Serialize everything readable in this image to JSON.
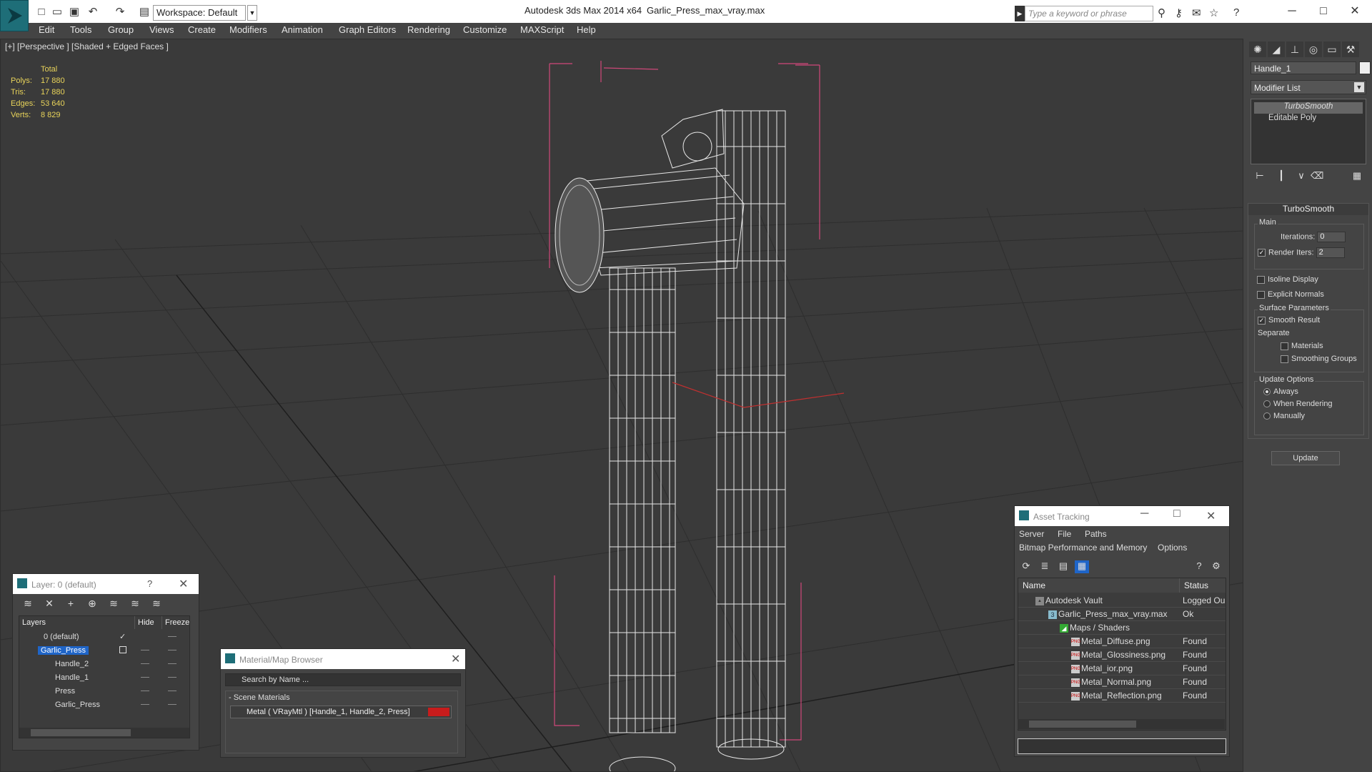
{
  "titlebar": {
    "workspace": "Workspace: Default",
    "app_title": "Autodesk 3ds Max  2014 x64",
    "file_title": "Garlic_Press_max_vray.max",
    "search_placeholder": "Type a keyword or phrase"
  },
  "menubar": [
    "Edit",
    "Tools",
    "Group",
    "Views",
    "Create",
    "Modifiers",
    "Animation",
    "Graph Editors",
    "Rendering",
    "Customize",
    "MAXScript",
    "Help"
  ],
  "viewport": {
    "label": "[+] [Perspective ] [Shaded + Edged Faces ]",
    "stats_header": "Total",
    "stats": [
      {
        "label": "Polys:",
        "value": "17 880"
      },
      {
        "label": "Tris:",
        "value": "17 880"
      },
      {
        "label": "Edges:",
        "value": "53 640"
      },
      {
        "label": "Verts:",
        "value": "8 829"
      }
    ]
  },
  "command_panel": {
    "object_name": "Handle_1",
    "modifier_list": "Modifier List",
    "stack": [
      "TurboSmooth",
      "Editable Poly"
    ],
    "turbosmooth": {
      "title": "TurboSmooth",
      "main_label": "Main",
      "iterations_label": "Iterations:",
      "iterations_value": "0",
      "render_iters_label": "Render Iters:",
      "render_iters_value": "2",
      "isoline_display": "Isoline Display",
      "explicit_normals": "Explicit Normals",
      "surface_params": "Surface Parameters",
      "smooth_result": "Smooth Result",
      "separate": "Separate",
      "materials": "Materials",
      "smoothing_groups": "Smoothing Groups",
      "update_options": "Update Options",
      "always": "Always",
      "when_rendering": "When Rendering",
      "manually": "Manually",
      "update_button": "Update"
    }
  },
  "layer_panel": {
    "title": "Layer: 0 (default)",
    "help": "?",
    "col_layers": "Layers",
    "col_hide": "Hide",
    "col_freeze": "Freeze",
    "rows": [
      "0 (default)",
      "Garlic_Press",
      "Handle_2",
      "Handle_1",
      "Press",
      "Garlic_Press"
    ]
  },
  "material_panel": {
    "title": "Material/Map Browser",
    "search_placeholder": "Search by Name ...",
    "section": "- Scene Materials",
    "item": "Metal  ( VRayMtl )  [Handle_1, Handle_2, Press]"
  },
  "asset_panel": {
    "title": "Asset Tracking",
    "menu": [
      "Server",
      "File",
      "Paths",
      "Bitmap Performance and Memory",
      "Options"
    ],
    "col_name": "Name",
    "col_status": "Status",
    "rows": [
      {
        "name": "Autodesk Vault",
        "status": "Logged Ou"
      },
      {
        "name": "Garlic_Press_max_vray.max",
        "status": "Ok"
      },
      {
        "name": "Maps / Shaders",
        "status": ""
      },
      {
        "name": "Metal_Diffuse.png",
        "status": "Found"
      },
      {
        "name": "Metal_Glossiness.png",
        "status": "Found"
      },
      {
        "name": "Metal_ior.png",
        "status": "Found"
      },
      {
        "name": "Metal_Normal.png",
        "status": "Found"
      },
      {
        "name": "Metal_Reflection.png",
        "status": "Found"
      }
    ]
  },
  "colors": {
    "accent": "#1e6e78",
    "selection": "#1f65c8",
    "stats": "#e8d35a",
    "material_swatch": "#c81c1c",
    "bbox": "#d0487a"
  }
}
